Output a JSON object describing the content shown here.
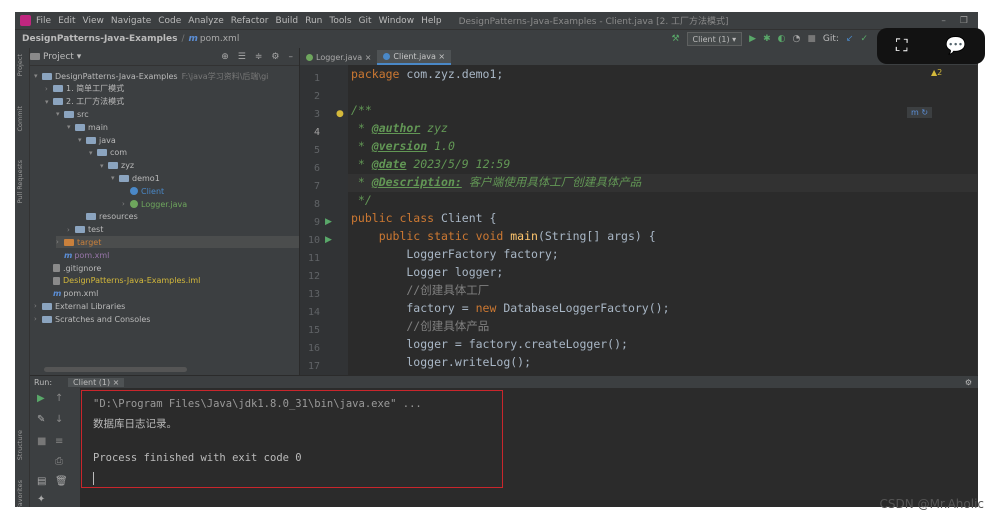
{
  "menubar": {
    "items": [
      "File",
      "Edit",
      "View",
      "Navigate",
      "Code",
      "Analyze",
      "Refactor",
      "Build",
      "Run",
      "Tools",
      "Git",
      "Window",
      "Help"
    ],
    "title": "DesignPatterns-Java-Examples - Client.java [2. 工厂方法模式]"
  },
  "navbar": {
    "project": "DesignPatterns-Java-Examples",
    "file": "pom.xml",
    "run_config": "Client (1)",
    "git_label": "Git:"
  },
  "project_panel": {
    "title": "Project",
    "tree": [
      {
        "label": "DesignPatterns-Java-Examples",
        "suffix": "F:\\java学习资料\\后端\\gi",
        "indent": 0,
        "icon": "folder",
        "arrow": "▾"
      },
      {
        "label": "1. 简单工厂模式",
        "indent": 1,
        "icon": "folder",
        "arrow": "›"
      },
      {
        "label": "2. 工厂方法模式",
        "indent": 1,
        "icon": "folder",
        "arrow": "▾"
      },
      {
        "label": "src",
        "indent": 2,
        "icon": "folder",
        "arrow": "▾"
      },
      {
        "label": "main",
        "indent": 3,
        "icon": "folder",
        "arrow": "▾"
      },
      {
        "label": "java",
        "indent": 4,
        "icon": "folder",
        "arrow": "▾"
      },
      {
        "label": "com",
        "indent": 5,
        "icon": "folder",
        "arrow": "▾"
      },
      {
        "label": "zyz",
        "indent": 6,
        "icon": "folder",
        "arrow": "▾"
      },
      {
        "label": "demo1",
        "indent": 7,
        "icon": "folder",
        "arrow": "▾"
      },
      {
        "label": "Client",
        "indent": 8,
        "icon": "class",
        "arrow": ""
      },
      {
        "label": "Logger.java",
        "indent": 8,
        "icon": "class-green",
        "arrow": "›"
      },
      {
        "label": "resources",
        "indent": 4,
        "icon": "folder",
        "arrow": ""
      },
      {
        "label": "test",
        "indent": 3,
        "icon": "folder",
        "arrow": "›"
      },
      {
        "label": "target",
        "indent": 2,
        "icon": "folder-orange",
        "arrow": "›"
      },
      {
        "label": "pom.xml",
        "indent": 2,
        "icon": "maven",
        "arrow": ""
      },
      {
        "label": ".gitignore",
        "indent": 1,
        "icon": "file",
        "arrow": ""
      },
      {
        "label": "DesignPatterns-Java-Examples.iml",
        "indent": 1,
        "icon": "file",
        "arrow": ""
      },
      {
        "label": "pom.xml",
        "indent": 1,
        "icon": "maven",
        "arrow": ""
      },
      {
        "label": "External Libraries",
        "indent": 0,
        "icon": "folder",
        "arrow": "›"
      },
      {
        "label": "Scratches and Consoles",
        "indent": 0,
        "icon": "folder",
        "arrow": "›"
      }
    ]
  },
  "editor": {
    "tabs": [
      "Logger.java",
      "Client.java"
    ],
    "active_tab": 1,
    "line_numbers": [
      "1",
      "2",
      "3",
      "4",
      "5",
      "6",
      "7",
      "8",
      "9",
      "10",
      "11",
      "12",
      "13",
      "14",
      "15",
      "16",
      "17"
    ],
    "indicator": "▲2",
    "code": {
      "l1_kw": "package",
      "l1_rest": " com.zyz.demo1;",
      "l3": "/**",
      "l4_pre": " * ",
      "l4_tag": "@author",
      "l4_val": " zyz",
      "l5_pre": " * ",
      "l5_tag": "@version",
      "l5_val": " 1.0",
      "l6_pre": " * ",
      "l6_tag": "@date",
      "l6_val": " 2023/5/9 12:59",
      "l7_pre": " * ",
      "l7_tag": "@Description:",
      "l7_val": " 客户端使用具体工厂创建具体产品",
      "l8": " */",
      "l9_kw": "public class",
      "l9_rest": " Client {",
      "l10_kw": "    public static void",
      "l10_fn": " main",
      "l10_rest": "(String[] args) {",
      "l11": "        LoggerFactory factory;",
      "l12": "        Logger logger;",
      "l13": "        //创建具体工厂",
      "l14_pre": "        factory = ",
      "l14_kw": "new",
      "l14_rest": " DatabaseLoggerFactory();",
      "l15": "        //创建具体产品",
      "l16": "        logger = factory.createLogger();",
      "l17": "        logger.writeLog();"
    }
  },
  "run_panel": {
    "label": "Run:",
    "tab": "Client (1)",
    "console": [
      "\"D:\\Program Files\\Java\\jdk1.8.0_31\\bin\\java.exe\" ...",
      "数据库日志记录。",
      "",
      "Process finished with exit code 0"
    ]
  },
  "watermark": "CSDN @Mr.Aholic"
}
